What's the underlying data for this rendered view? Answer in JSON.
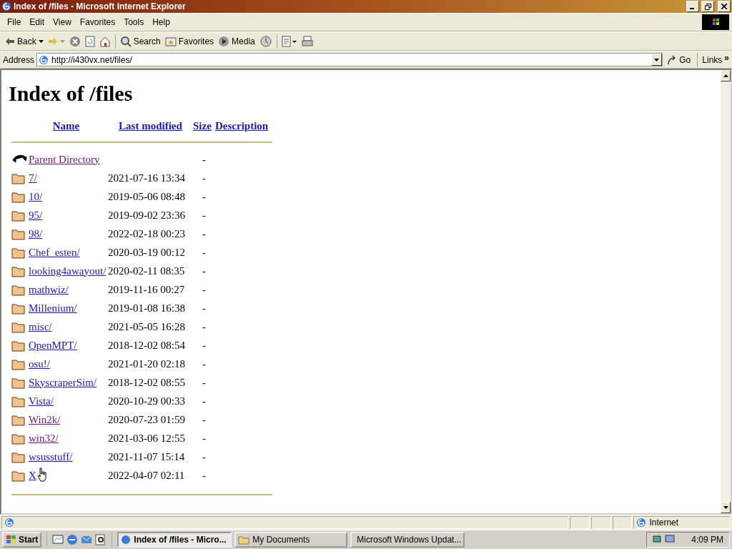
{
  "window": {
    "title": "Index of /files - Microsoft Internet Explorer"
  },
  "menu": [
    "File",
    "Edit",
    "View",
    "Favorites",
    "Tools",
    "Help"
  ],
  "toolbar": [
    {
      "kind": "back",
      "label": "Back"
    },
    {
      "kind": "forward"
    },
    {
      "kind": "stop"
    },
    {
      "kind": "refresh"
    },
    {
      "kind": "home"
    },
    {
      "kind": "search",
      "label": "Search"
    },
    {
      "kind": "favorites",
      "label": "Favorites"
    },
    {
      "kind": "media",
      "label": "Media"
    },
    {
      "kind": "history"
    },
    {
      "kind": "edit"
    },
    {
      "kind": "print"
    }
  ],
  "address": {
    "label": "Address",
    "value": "http://i430vx.net/files/",
    "go": "Go",
    "links": "Links",
    "more": "»"
  },
  "page": {
    "heading": "Index of /files",
    "columns": [
      "Name",
      "Last modified",
      "Size",
      "Description"
    ],
    "rows": [
      {
        "kind": "parent",
        "name": "Parent Directory",
        "modified": "",
        "size": "-",
        "visited": true
      },
      {
        "kind": "folder",
        "name": "7/",
        "modified": "2021-07-16 13:34",
        "size": "-",
        "visited": false
      },
      {
        "kind": "folder",
        "name": "10/",
        "modified": "2019-05-06 08:48",
        "size": "-",
        "visited": false
      },
      {
        "kind": "folder",
        "name": "95/",
        "modified": "2019-09-02 23:36",
        "size": "-",
        "visited": false
      },
      {
        "kind": "folder",
        "name": "98/",
        "modified": "2022-02-18 00:23",
        "size": "-",
        "visited": false
      },
      {
        "kind": "folder",
        "name": "Chef_esten/",
        "modified": "2020-03-19 00:12",
        "size": "-",
        "visited": false
      },
      {
        "kind": "folder",
        "name": "looking4awayout/",
        "modified": "2020-02-11 08:35",
        "size": "-",
        "visited": false
      },
      {
        "kind": "folder",
        "name": "mathwiz/",
        "modified": "2019-11-16 00:27",
        "size": "-",
        "visited": false
      },
      {
        "kind": "folder",
        "name": "Millenium/",
        "modified": "2019-01-08 16:38",
        "size": "-",
        "visited": false
      },
      {
        "kind": "folder",
        "name": "misc/",
        "modified": "2021-05-05 16:28",
        "size": "-",
        "visited": false
      },
      {
        "kind": "folder",
        "name": "OpenMPT/",
        "modified": "2018-12-02 08:54",
        "size": "-",
        "visited": false
      },
      {
        "kind": "folder",
        "name": "osu!/",
        "modified": "2021-01-20 02:18",
        "size": "-",
        "visited": false
      },
      {
        "kind": "folder",
        "name": "SkyscraperSim/",
        "modified": "2018-12-02 08:55",
        "size": "-",
        "visited": false
      },
      {
        "kind": "folder",
        "name": "Vista/",
        "modified": "2020-10-29 00:33",
        "size": "-",
        "visited": false
      },
      {
        "kind": "folder",
        "name": "Win2k/",
        "modified": "2020-07-23 01:59",
        "size": "-",
        "visited": true
      },
      {
        "kind": "folder",
        "name": "win32/",
        "modified": "2021-03-06 12:55",
        "size": "-",
        "visited": true
      },
      {
        "kind": "folder",
        "name": "wsusstuff/",
        "modified": "2021-11-07 15:14",
        "size": "-",
        "visited": false
      },
      {
        "kind": "folder",
        "name": "X",
        "modified": "2022-04-07 02:11",
        "size": "-",
        "visited": false,
        "hovered": true
      }
    ]
  },
  "status_bar": {
    "zone": "Internet"
  },
  "taskbar": {
    "start": "Start",
    "tasks": [
      {
        "label": "Index of /files - Micro...",
        "selected": true
      },
      {
        "label": "My Documents",
        "selected": false
      },
      {
        "label": "Microsoft Windows Updat...",
        "selected": false
      }
    ],
    "clock": "4:09 PM"
  }
}
